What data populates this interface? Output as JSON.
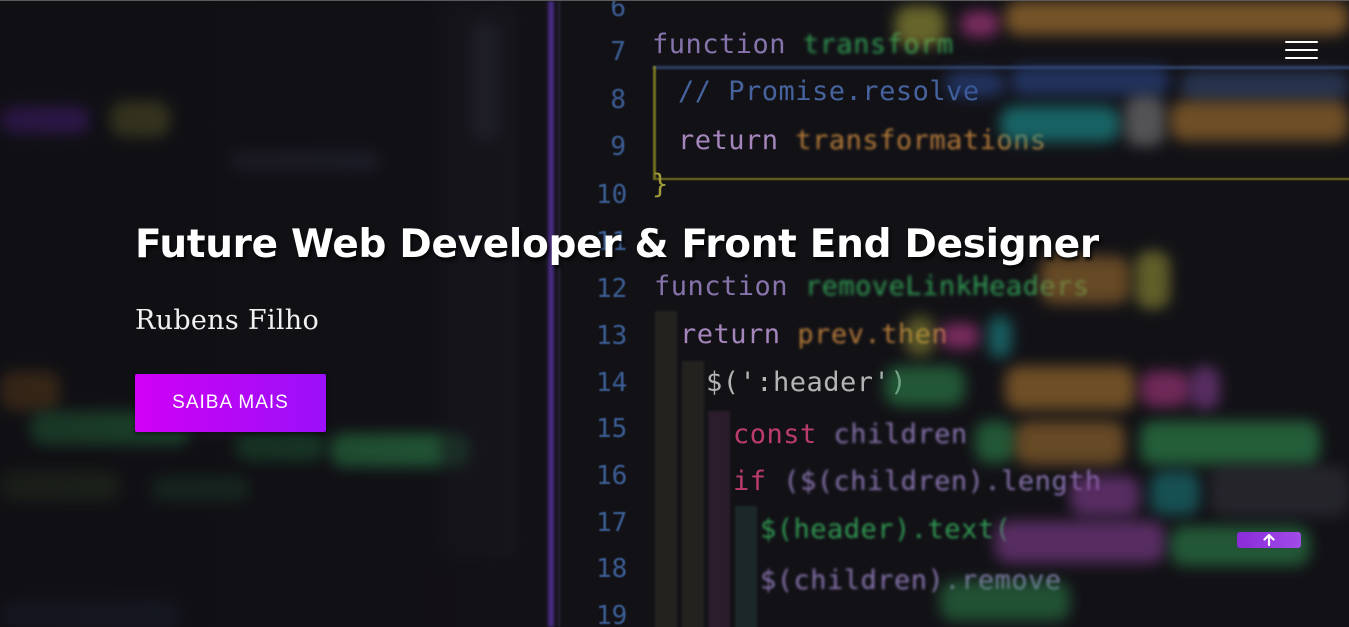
{
  "hero": {
    "title": "Future Web Developer & Front End Designer",
    "subtitle": "Rubens Filho",
    "cta_label": "SAIBA MAIS"
  },
  "nav": {
    "menu_icon": "hamburger-menu-icon"
  },
  "scroll_top": {
    "icon": "arrow-up-icon"
  },
  "background": {
    "line_numbers": [
      "6",
      "7",
      "8",
      "9",
      "10",
      "11",
      "12",
      "13",
      "14",
      "15",
      "16",
      "17",
      "18",
      "19"
    ],
    "code": {
      "l7_kw": "function",
      "l7_fn": "transform",
      "l8": "// Promise.resolve",
      "l9_kw": "return",
      "l9_tr": "transformations",
      "l10": "}",
      "l12_kw": "function",
      "l12_fn": "removeLinkHeaders",
      "l13_kw": "return",
      "l13_tr": "prev.then",
      "l14": "$(':header')",
      "l15_kw": "const",
      "l15_rest": "children",
      "l16_kw": "if",
      "l16_rest": "($(children).length",
      "l17": "$(header).text(",
      "l18": "$(children).remove"
    }
  },
  "colors": {
    "cta_gradient_start": "#d000f5",
    "cta_gradient_end": "#9a10f8",
    "scroll_top_bg": "#8a2bd8",
    "title_text": "#ffffff"
  }
}
